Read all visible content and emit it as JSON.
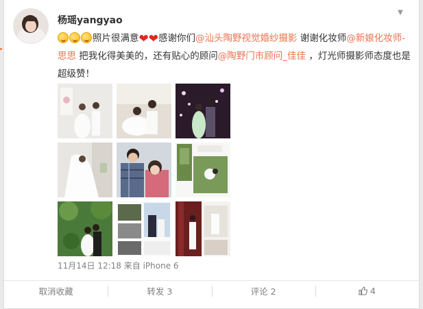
{
  "post": {
    "username": "杨瑶yangyao",
    "text_segments": {
      "s1": "照片很满意",
      "s2": "感谢你们",
      "link1": "@汕头陶野视觉婚纱摄影",
      "s3": " 谢谢化妆师",
      "link2": "@新娘化妆师-思思",
      "s4": " 把我化得美美的，还有贴心的顾问",
      "link3": "@陶野门市顾问_佳佳",
      "s5": " ，灯光师摄影师态度也是超级赞！"
    },
    "emoji_count": 3,
    "heart_count": 2,
    "meta": "11月14日 12:18 来自 iPhone 6"
  },
  "actions": {
    "favorite": "取消收藏",
    "repost": "转发 3",
    "comment": "评论 2",
    "like": "4"
  },
  "photos": [
    {
      "id": 1,
      "subject": "wedding-couple-white-room"
    },
    {
      "id": 2,
      "subject": "wedding-couple-sitting"
    },
    {
      "id": 3,
      "subject": "couple-night-lights"
    },
    {
      "id": 4,
      "subject": "bride-veil-white"
    },
    {
      "id": 5,
      "subject": "couple-plaid-shirt"
    },
    {
      "id": 6,
      "subject": "collage-outdoor-trees"
    },
    {
      "id": 7,
      "subject": "couple-garden-kiss"
    },
    {
      "id": 8,
      "subject": "collage-black-white"
    },
    {
      "id": 9,
      "subject": "collage-red-curtains"
    }
  ],
  "colors": {
    "link": "#eb7350",
    "text": "#333333",
    "meta": "#808080",
    "background": "#eaeaea"
  }
}
